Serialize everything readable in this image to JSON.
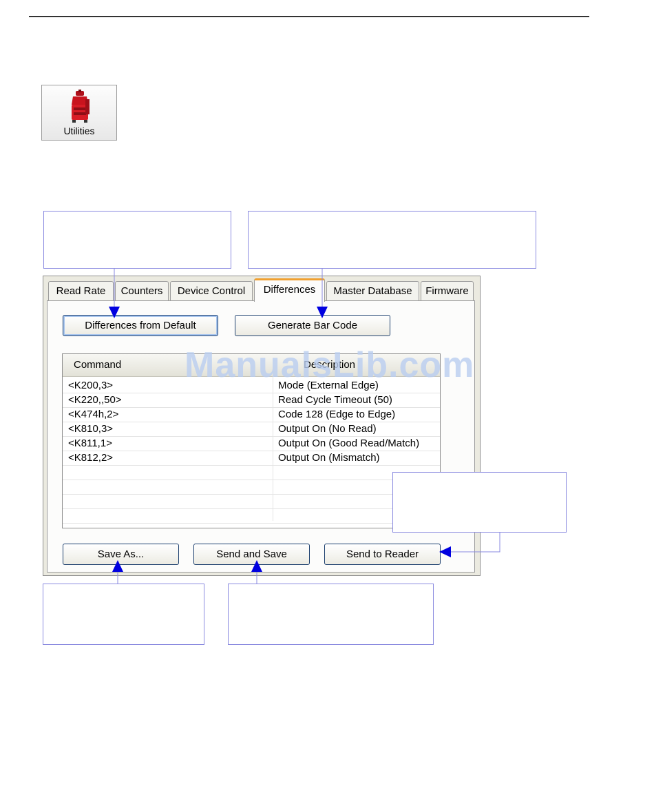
{
  "toolbar": {
    "utilities_label": "Utilities",
    "utilities_icon": "toolbox-icon"
  },
  "tabs": [
    {
      "label": "Read Rate",
      "active": false
    },
    {
      "label": "Counters",
      "active": false
    },
    {
      "label": "Device Control",
      "active": false
    },
    {
      "label": "Differences",
      "active": true
    },
    {
      "label": "Master Database",
      "active": false
    },
    {
      "label": "Firmware",
      "active": false
    }
  ],
  "buttons": {
    "differences_from_default": "Differences from Default",
    "generate_bar_code": "Generate Bar Code",
    "save_as": "Save As...",
    "send_and_save": "Send and Save",
    "send_to_reader": "Send to Reader"
  },
  "table": {
    "headers": [
      "Command",
      "Description"
    ],
    "rows": [
      {
        "command": "<K200,3>",
        "description": "Mode (External Edge)"
      },
      {
        "command": "<K220,,50>",
        "description": "Read Cycle Timeout (50)"
      },
      {
        "command": "<K474h,2>",
        "description": "Code 128 (Edge to Edge)"
      },
      {
        "command": "<K810,3>",
        "description": "Output On (No Read)"
      },
      {
        "command": "<K811,1>",
        "description": "Output On (Good Read/Match)"
      },
      {
        "command": "<K812,2>",
        "description": "Output On (Mismatch)"
      },
      {
        "command": "",
        "description": ""
      },
      {
        "command": "",
        "description": ""
      },
      {
        "command": "",
        "description": ""
      },
      {
        "command": "",
        "description": ""
      }
    ]
  },
  "watermark": "ManualsLib.com",
  "colors": {
    "arrow": "#0000e0",
    "active_tab_accent": "#f0a030",
    "callout_border": "#8a8ae0"
  }
}
